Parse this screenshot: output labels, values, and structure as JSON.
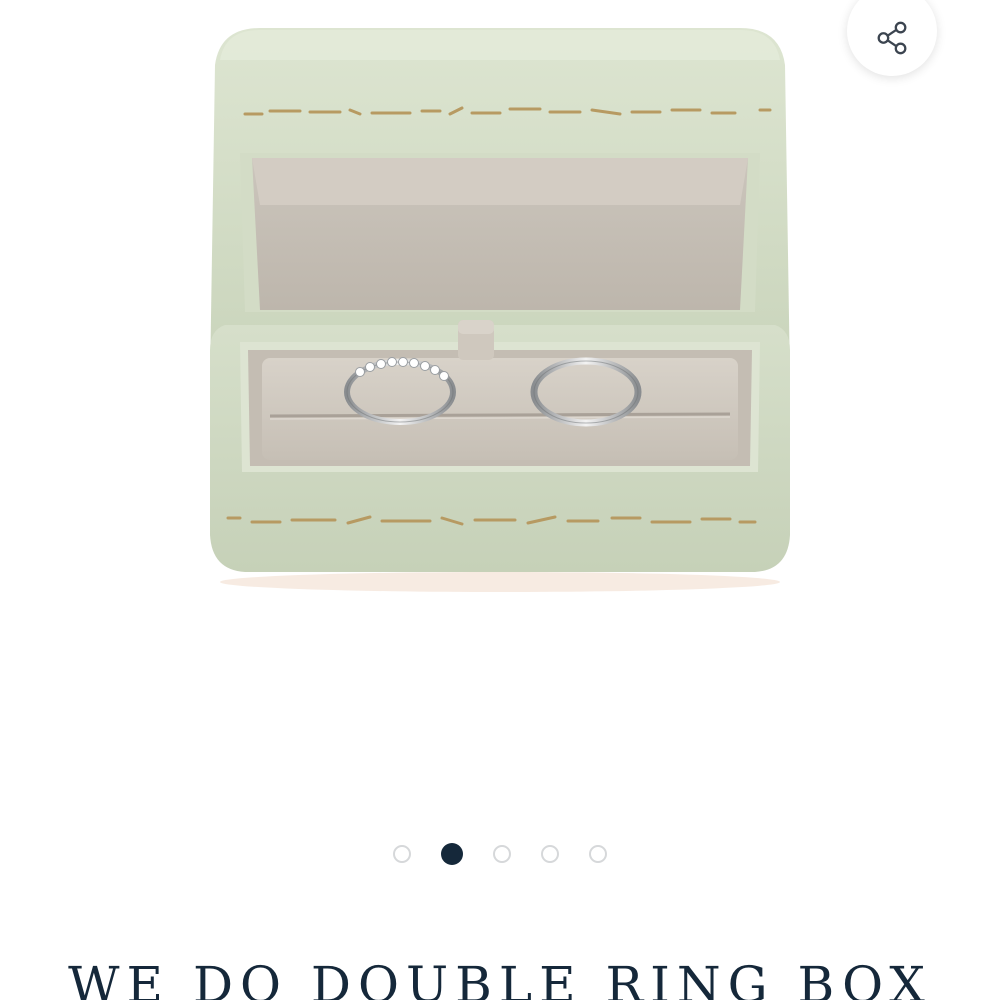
{
  "share": {
    "icon": "share-icon"
  },
  "gallery": {
    "image_alt": "WE DO DOUBLE RING BOX",
    "total_slides": 5,
    "active_slide": 2,
    "box_color": "#d1dbc4",
    "accent_color": "#15283a"
  },
  "product": {
    "title": "WE DO DOUBLE RING BOX"
  }
}
